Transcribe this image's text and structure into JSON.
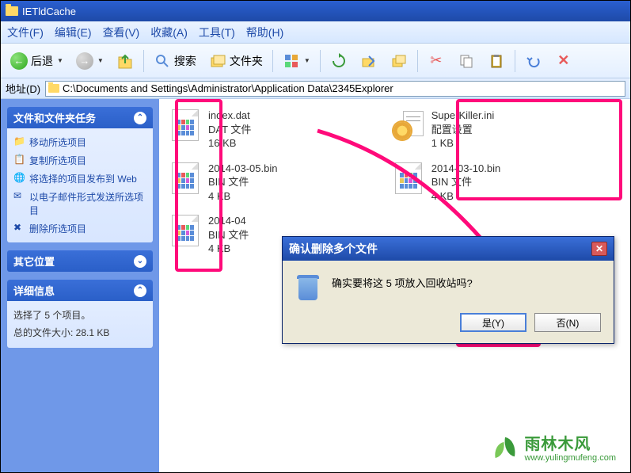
{
  "titlebar": {
    "title": "IETldCache"
  },
  "menu": {
    "file": "文件(F)",
    "edit": "编辑(E)",
    "view": "查看(V)",
    "favorites": "收藏(A)",
    "tools": "工具(T)",
    "help": "帮助(H)"
  },
  "toolbar": {
    "back": "后退",
    "search": "搜索",
    "folders": "文件夹"
  },
  "addressbar": {
    "label": "地址(D)",
    "path": "C:\\Documents and Settings\\Administrator\\Application Data\\2345Explorer"
  },
  "sidebar": {
    "tasks_title": "文件和文件夹任务",
    "tasks": [
      "移动所选项目",
      "复制所选项目",
      "将选择的项目发布到 Web",
      "以电子邮件形式发送所选项目",
      "删除所选项目"
    ],
    "other_title": "其它位置",
    "details_title": "详细信息",
    "details_line1": "选择了 5 个项目。",
    "details_line2": "总的文件大小: 28.1 KB"
  },
  "files": [
    {
      "name": "index.dat",
      "type": "DAT 文件",
      "size": "16 KB",
      "icon": "doc"
    },
    {
      "name": "2014-03-05.bin",
      "type": "BIN 文件",
      "size": "4 KB",
      "icon": "doc"
    },
    {
      "name": "2014-04",
      "type": "BIN 文件",
      "size": "4 KB",
      "icon": "doc"
    },
    {
      "name": "SuperKiller.ini",
      "type": "配置设置",
      "size": "1 KB",
      "icon": "ini"
    },
    {
      "name": "2014-03-10.bin",
      "type": "BIN 文件",
      "size": "4 KB",
      "icon": "doc"
    }
  ],
  "dialog": {
    "title": "确认删除多个文件",
    "message": "确实要将这 5 项放入回收站吗?",
    "yes": "是(Y)",
    "no": "否(N)"
  },
  "watermark": {
    "cn": "雨林木风",
    "url": "www.yulingmufeng.com"
  }
}
